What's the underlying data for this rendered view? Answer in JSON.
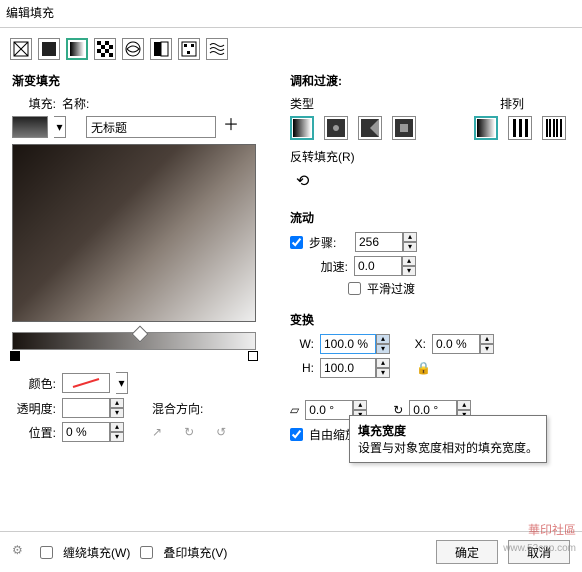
{
  "window_title": "编辑填充",
  "left": {
    "title": "渐变填充",
    "fill_label": "填充:",
    "name_label": "名称:",
    "name_value": "无标题",
    "color_label": "颜色:",
    "opacity_label": "透明度:",
    "blend_label": "混合方向:",
    "pos_label": "位置:",
    "pos_value": "0 %"
  },
  "right": {
    "harmony_title": "调和过渡:",
    "type_label": "类型",
    "arrange_label": "排列",
    "reverse_label": "反转填充(R)",
    "flow_title": "流动",
    "steps_label": "步骤:",
    "steps_value": "256",
    "accel_label": "加速:",
    "accel_value": "0.0",
    "smooth_label": "平滑过渡",
    "transform_title": "变换",
    "w_label": "W:",
    "w_value": "100.0 %",
    "x_label": "X:",
    "x_value": "0.0 %",
    "h_label": "H:",
    "h_value": "100.0",
    "rot_value": "0.0 °",
    "skew_value": "0.0 °",
    "free_label": "自由缩放和倾斜(F)"
  },
  "bottom": {
    "wrap_label": "缠绕填充(W)",
    "overprint_label": "叠印填充(V)",
    "ok": "确定",
    "cancel": "取消"
  },
  "tooltip": {
    "title": "填充宽度",
    "body": "设置与对象宽度相对的填充宽度。"
  },
  "watermark": {
    "brand": "華印社區",
    "url": "www.52cnp.com"
  }
}
